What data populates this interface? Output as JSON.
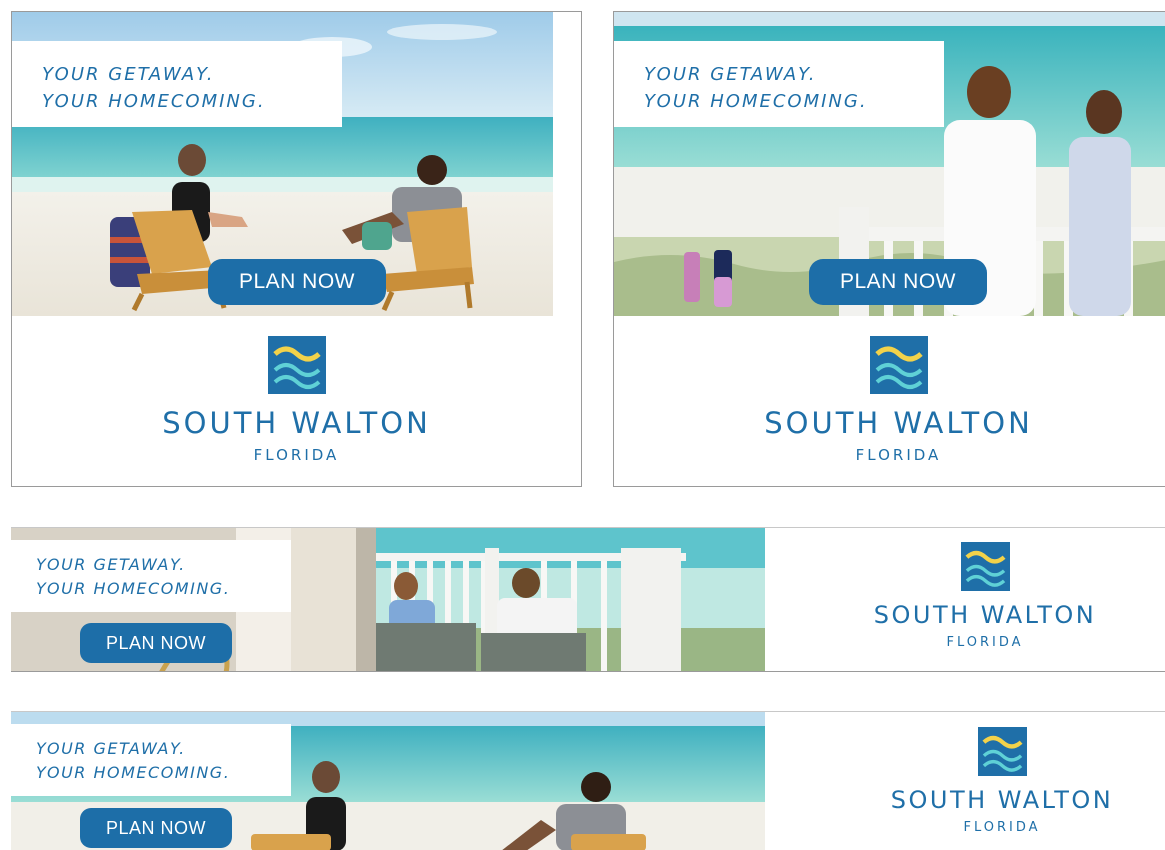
{
  "headline": {
    "line1": "YOUR GETAWAY.",
    "line2": "YOUR HOMECOMING."
  },
  "cta": {
    "label": "PLAN NOW"
  },
  "brand": {
    "name": "SOUTH WALTON",
    "state": "FLORIDA"
  },
  "icons": {
    "logo": "wave-square-icon"
  },
  "colors": {
    "brand_blue": "#1f6fa8",
    "button_blue": "#1d6ea8",
    "wave_yellow": "#f2d24a",
    "wave_aqua": "#5fd1d6"
  }
}
